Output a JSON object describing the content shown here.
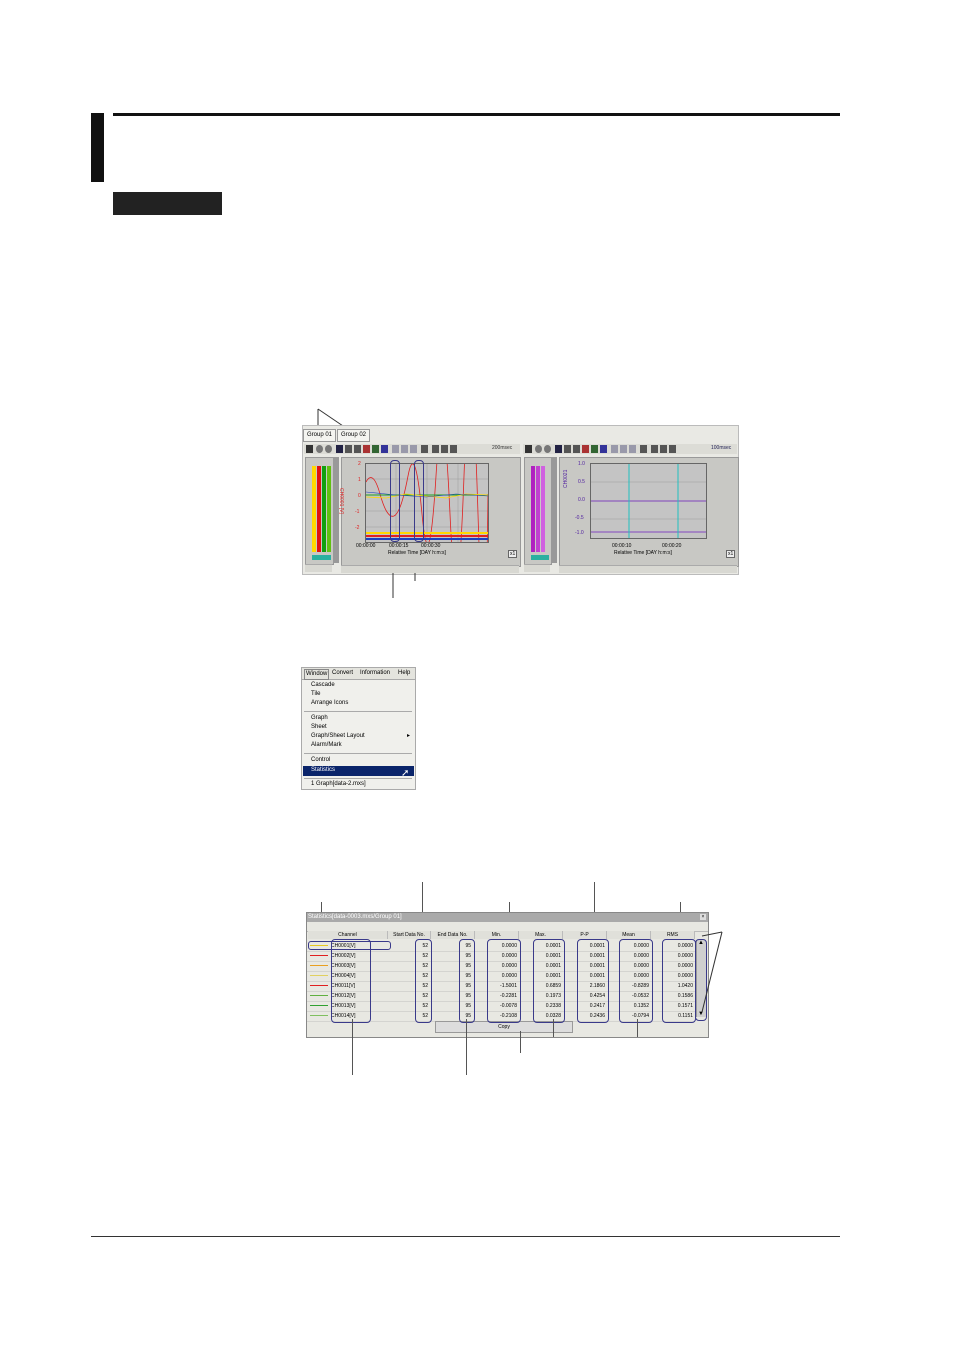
{
  "graph": {
    "tabs": [
      "Group 01",
      "Group 02"
    ],
    "left": {
      "rate": "200msec",
      "ylabel": "CH0001 [V]",
      "xlabel": "Relative Time [DAY h:m:s]",
      "yticks": [
        "2",
        "1",
        "0",
        "-1",
        "-2"
      ],
      "xticks": [
        "00:00:00",
        "00:00:15",
        "00:00:30"
      ],
      "zoom": "x1"
    },
    "right": {
      "rate": "100msec",
      "ylabel": "CH0021",
      "xlabel": "Relative Time [DAY h:m:s]",
      "yticks": [
        "1.0",
        "0.5",
        "0.0",
        "-0.5",
        "-1.0"
      ],
      "xticks": [
        "00:00:10",
        "00:00:20"
      ],
      "zoom": "x1"
    }
  },
  "menu": {
    "bar": [
      "Window",
      "Convert",
      "Information",
      "Help"
    ],
    "group1": [
      "Cascade",
      "Tile",
      "Arrange Icons"
    ],
    "group2": [
      "Graph",
      "Sheet",
      "Graph/Sheet Layout",
      "Alarm/Mark"
    ],
    "group3": [
      "Control",
      "Statistics"
    ],
    "recent": "1 Graph[data-2.mxs]"
  },
  "stats": {
    "title": "Statistics[data-0003.mxs/Group 01]",
    "headers": [
      "Channel",
      "Start Data No.",
      "End Data No.",
      "Min.",
      "Max.",
      "P-P",
      "Mean",
      "RMS"
    ],
    "rows": [
      [
        "CH0001[V]",
        "52",
        "95",
        "0.0000",
        "0.0001",
        "0.0001",
        "0.0000",
        "0.0000"
      ],
      [
        "CH0002[V]",
        "52",
        "95",
        "0.0000",
        "0.0001",
        "0.0001",
        "0.0000",
        "0.0000"
      ],
      [
        "CH0003[V]",
        "52",
        "95",
        "0.0000",
        "0.0001",
        "0.0001",
        "0.0000",
        "0.0000"
      ],
      [
        "CH0004[V]",
        "52",
        "95",
        "0.0000",
        "0.0001",
        "0.0001",
        "0.0000",
        "0.0000"
      ],
      [
        "CH0011[V]",
        "52",
        "95",
        "-1.5001",
        "0.6859",
        "2.1860",
        "-0.8289",
        "1.0420"
      ],
      [
        "CH0012[V]",
        "52",
        "95",
        "-0.2281",
        "0.1973",
        "0.4254",
        "-0.0532",
        "0.1586"
      ],
      [
        "CH0013[V]",
        "52",
        "95",
        "-0.0078",
        "0.2338",
        "0.2417",
        "0.1352",
        "0.1571"
      ],
      [
        "CH0014[V]",
        "52",
        "95",
        "-0.2108",
        "0.0328",
        "0.2436",
        "-0.0794",
        "0.1151"
      ]
    ],
    "copy_label": "Copy"
  },
  "colors": {
    "accent": "#0a246a",
    "oval": "#3a3a8a"
  }
}
